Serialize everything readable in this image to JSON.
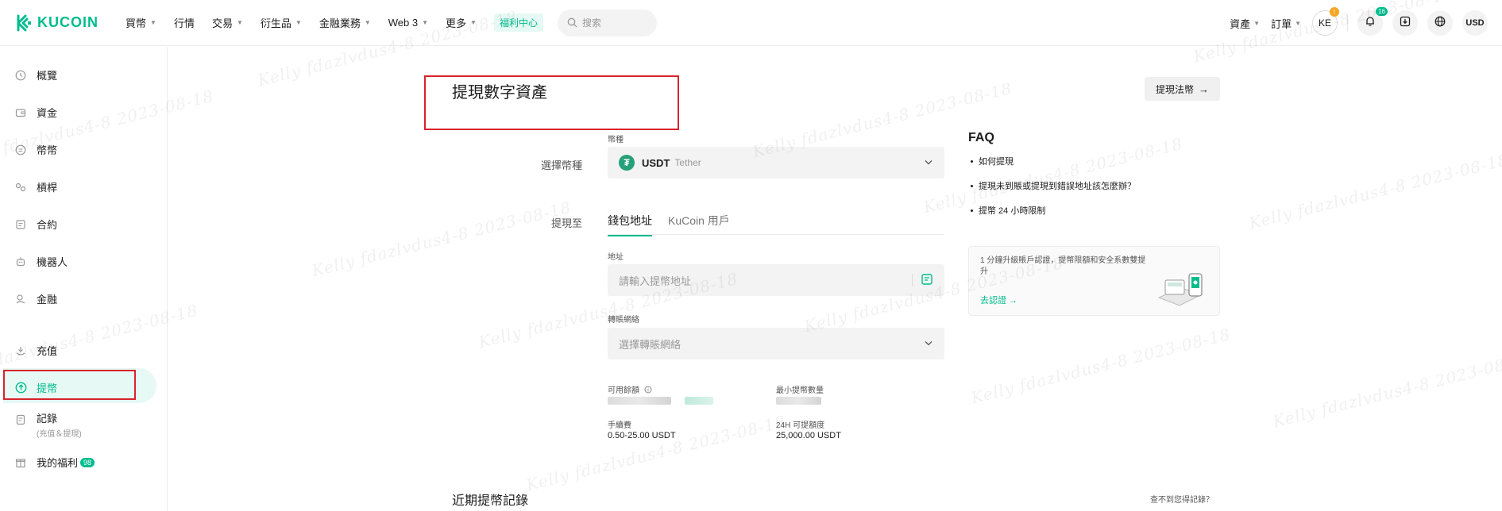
{
  "brand": {
    "name": "KUCOIN",
    "color": "#01bc8d"
  },
  "topnav": {
    "items": [
      {
        "label": "買幣",
        "caret": true
      },
      {
        "label": "行情",
        "caret": false
      },
      {
        "label": "交易",
        "caret": true
      },
      {
        "label": "衍生品",
        "caret": true
      },
      {
        "label": "金融業務",
        "caret": true
      },
      {
        "label": "Web 3",
        "caret": true
      },
      {
        "label": "更多",
        "caret": true
      }
    ],
    "welfare_tag": "福利中心",
    "search_placeholder": "搜索",
    "right": {
      "assets": "資產",
      "orders": "訂單",
      "avatar": "KE",
      "avatar_badge": "!",
      "notification_count": "16",
      "currency": "USD"
    }
  },
  "sidebar": {
    "items": [
      {
        "label": "概覽",
        "icon": "clock-icon"
      },
      {
        "label": "資金",
        "icon": "wallet-icon"
      },
      {
        "label": "幣幣",
        "icon": "exchange-icon"
      },
      {
        "label": "槓桿",
        "icon": "leverage-icon"
      },
      {
        "label": "合約",
        "icon": "contract-icon"
      },
      {
        "label": "機器人",
        "icon": "robot-icon"
      },
      {
        "label": "金融",
        "icon": "finance-icon"
      },
      {
        "label": "充值",
        "icon": "deposit-icon"
      },
      {
        "label": "提幣",
        "icon": "withdraw-icon",
        "active": true
      },
      {
        "label": "記錄",
        "sub": "(充值＆提現)",
        "icon": "record-icon"
      },
      {
        "label": "我的福利",
        "badge": "98",
        "icon": "gift-icon"
      }
    ]
  },
  "main": {
    "title": "提現數字資產",
    "fiat_button": "提現法幣",
    "coin_label": "選擇幣種",
    "coin_field_label": "幣種",
    "coin": {
      "symbol": "USDT",
      "name": "Tether"
    },
    "withdraw_to_label": "提現至",
    "tabs": [
      {
        "label": "錢包地址",
        "active": true
      },
      {
        "label": "KuCoin 用戶",
        "active": false
      }
    ],
    "address_label": "地址",
    "address_placeholder": "請輸入提幣地址",
    "network_label": "轉賬網絡",
    "network_placeholder": "選擇轉賬網絡",
    "available_label": "可用餘額",
    "min_label": "最小提幣數量",
    "fee_label": "手續費",
    "fee_value": "0.50-25.00 USDT",
    "limit_label": "24H 可提額度",
    "limit_value": "25,000.00 USDT",
    "recent_title": "近期提幣記錄",
    "recent_link": "查不到您得記錄？"
  },
  "faq": {
    "title": "FAQ",
    "items": [
      "如何提現",
      "提現未到賬或提現到錯誤地址該怎麼辦？",
      "提幣 24 小時限制"
    ],
    "kyc_text": "1 分鐘升級賬戶認證，提幣限額和安全系數雙提升",
    "kyc_link": "去認證 →"
  },
  "watermark": "Kelly fdazlvdus4-8 2023-08-18"
}
